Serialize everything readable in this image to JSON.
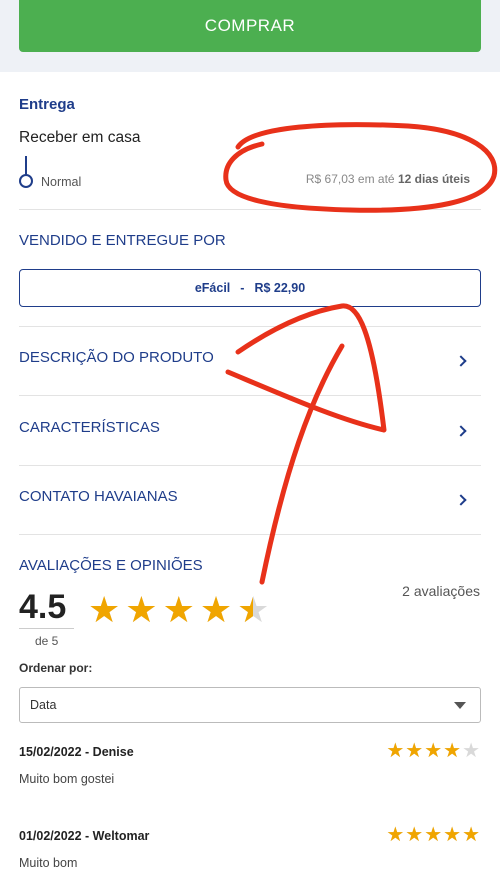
{
  "buy_button": {
    "label": "COMPRAR"
  },
  "delivery": {
    "title": "Entrega",
    "subtitle": "Receber em casa",
    "type": "Normal",
    "price_text": "R$ 67,03 em até",
    "deadline": "12 dias úteis"
  },
  "seller": {
    "title": "VENDIDO E ENTREGUE POR",
    "name": "eFácil",
    "separator": "-",
    "price": "R$ 22,90"
  },
  "sections": [
    {
      "label": "DESCRIÇÃO DO PRODUTO"
    },
    {
      "label": "CARACTERÍSTICAS"
    },
    {
      "label": "CONTATO HAVAIANAS"
    }
  ],
  "ratings": {
    "title": "AVALIAÇÕES E OPINIÕES",
    "score": "4.5",
    "scale": "de 5",
    "score_value": 4.5,
    "count_text": "2 avaliações",
    "sort_label": "Ordenar por:",
    "sort_value": "Data",
    "star_color": "#f0a500"
  },
  "reviews": [
    {
      "header": "15/02/2022 - Denise",
      "text": "Muito bom gostei",
      "stars": 4
    },
    {
      "header": "01/02/2022 - Weltomar",
      "text": "Muito bom",
      "stars": 5
    }
  ],
  "colors": {
    "brand_blue": "#1f3d8a",
    "buy_green": "#4caf50",
    "annotation_red": "#e8311a"
  }
}
